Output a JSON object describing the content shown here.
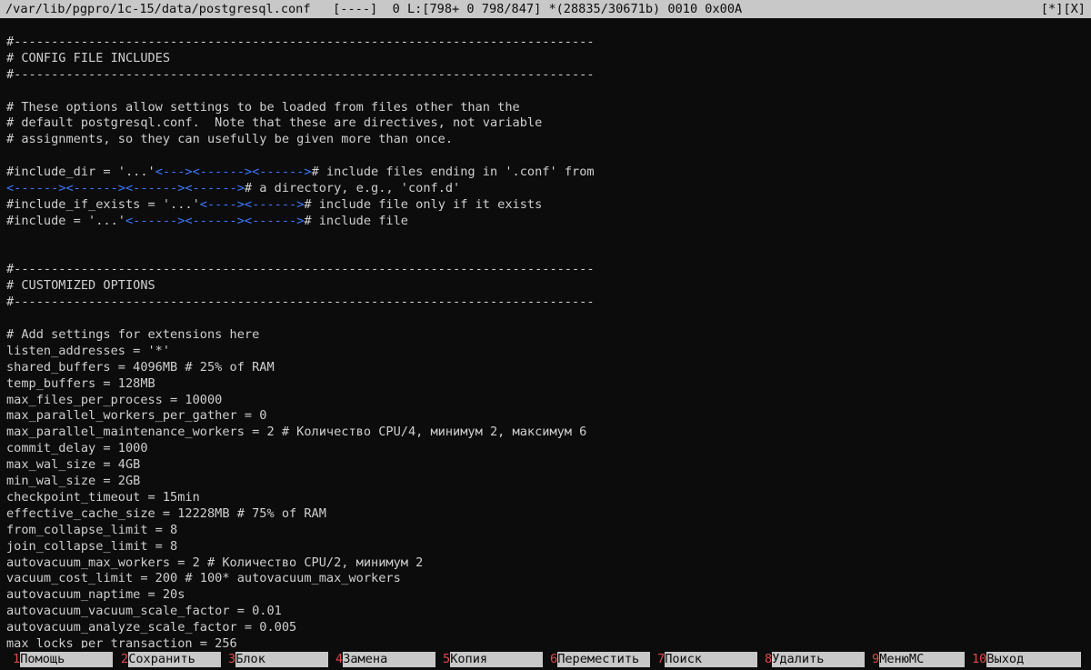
{
  "statusbar": {
    "text": "/var/lib/pgpro/1c-15/data/postgresql.conf   [----]  0 L:[798+ 0 798/847] *(28835/30671b) 0010 0x00A",
    "modified_marker": "[*]",
    "close_marker": "[X]"
  },
  "editor": {
    "lines": [
      {
        "text": "#------------------------------------------------------------------------------"
      },
      {
        "text": "# CONFIG FILE INCLUDES"
      },
      {
        "text": "#------------------------------------------------------------------------------"
      },
      {
        "text": ""
      },
      {
        "text": "# These options allow settings to be loaded from files other than the"
      },
      {
        "text": "# default postgresql.conf.  Note that these are directives, not variable"
      },
      {
        "text": "# assignments, so they can usefully be given more than once."
      },
      {
        "text": ""
      },
      {
        "segs": [
          {
            "t": "#include_dir = '...'"
          },
          {
            "t": "<---><------><------>",
            "c": "blue"
          },
          {
            "t": "# include files ending in '.conf' from"
          }
        ]
      },
      {
        "segs": [
          {
            "t": "<------><------><------><------>",
            "c": "blue"
          },
          {
            "t": "# a directory, e.g., 'conf.d'"
          }
        ]
      },
      {
        "segs": [
          {
            "t": "#include_if_exists = '...'"
          },
          {
            "t": "<----><------>",
            "c": "blue"
          },
          {
            "t": "# include file only if it exists"
          }
        ]
      },
      {
        "segs": [
          {
            "t": "#include = '...'"
          },
          {
            "t": "<------><------><------>",
            "c": "blue"
          },
          {
            "t": "# include file"
          }
        ]
      },
      {
        "text": ""
      },
      {
        "text": ""
      },
      {
        "text": "#------------------------------------------------------------------------------"
      },
      {
        "text": "# CUSTOMIZED OPTIONS"
      },
      {
        "text": "#------------------------------------------------------------------------------"
      },
      {
        "text": ""
      },
      {
        "text": "# Add settings for extensions here"
      },
      {
        "text": "listen_addresses = '*'"
      },
      {
        "text": "shared_buffers = 4096MB # 25% of RAM"
      },
      {
        "text": "temp_buffers = 128MB"
      },
      {
        "text": "max_files_per_process = 10000"
      },
      {
        "text": "max_parallel_workers_per_gather = 0"
      },
      {
        "text": "max_parallel_maintenance_workers = 2 # Количество CPU/4, минимум 2, максимум 6"
      },
      {
        "text": "commit_delay = 1000"
      },
      {
        "text": "max_wal_size = 4GB"
      },
      {
        "text": "min_wal_size = 2GB"
      },
      {
        "text": "checkpoint_timeout = 15min"
      },
      {
        "text": "effective_cache_size = 12228MB # 75% of RAM"
      },
      {
        "text": "from_collapse_limit = 8"
      },
      {
        "text": "join_collapse_limit = 8"
      },
      {
        "text": "autovacuum_max_workers = 2 # Количество CPU/2, минимум 2"
      },
      {
        "text": "vacuum_cost_limit = 200 # 100* autovacuum_max_workers"
      },
      {
        "text": "autovacuum_naptime = 20s"
      },
      {
        "text": "autovacuum_vacuum_scale_factor = 0.01"
      },
      {
        "text": "autovacuum_analyze_scale_factor = 0.005"
      },
      {
        "text": "max_locks_per_transaction = 256"
      }
    ]
  },
  "fkeys": [
    {
      "num": "1",
      "label": "Помощь"
    },
    {
      "num": "2",
      "label": "Сохранить"
    },
    {
      "num": "3",
      "label": "Блок"
    },
    {
      "num": "4",
      "label": "Замена"
    },
    {
      "num": "5",
      "label": "Копия"
    },
    {
      "num": "6",
      "label": "Переместить"
    },
    {
      "num": "7",
      "label": "Поиск"
    },
    {
      "num": "8",
      "label": "Удалить"
    },
    {
      "num": "9",
      "label": "МенюMC"
    },
    {
      "num": "10",
      "label": "Выход"
    }
  ],
  "colors": {
    "background": "#0c0c0c",
    "text": "#cfcfcf",
    "bar": "#c8c8c8",
    "tab_marker": "#3b78ff",
    "fkey_number": "#e04a4a"
  }
}
